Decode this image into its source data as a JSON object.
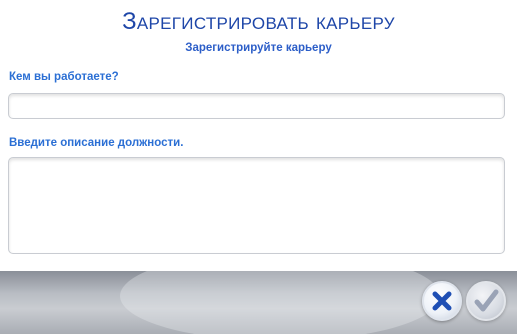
{
  "dialog": {
    "title": "Зарегистрировать карьеру",
    "subtitle": "Зарегистрируйте карьеру"
  },
  "fields": {
    "job": {
      "label": "Кем вы работаете?",
      "value": ""
    },
    "description": {
      "label": "Введите описание должности.",
      "value": ""
    }
  },
  "buttons": {
    "cancel_icon": "close-icon",
    "confirm_icon": "checkmark-icon",
    "cancel_color": "#1f4fb4",
    "confirm_color": "#9aa3b6"
  }
}
